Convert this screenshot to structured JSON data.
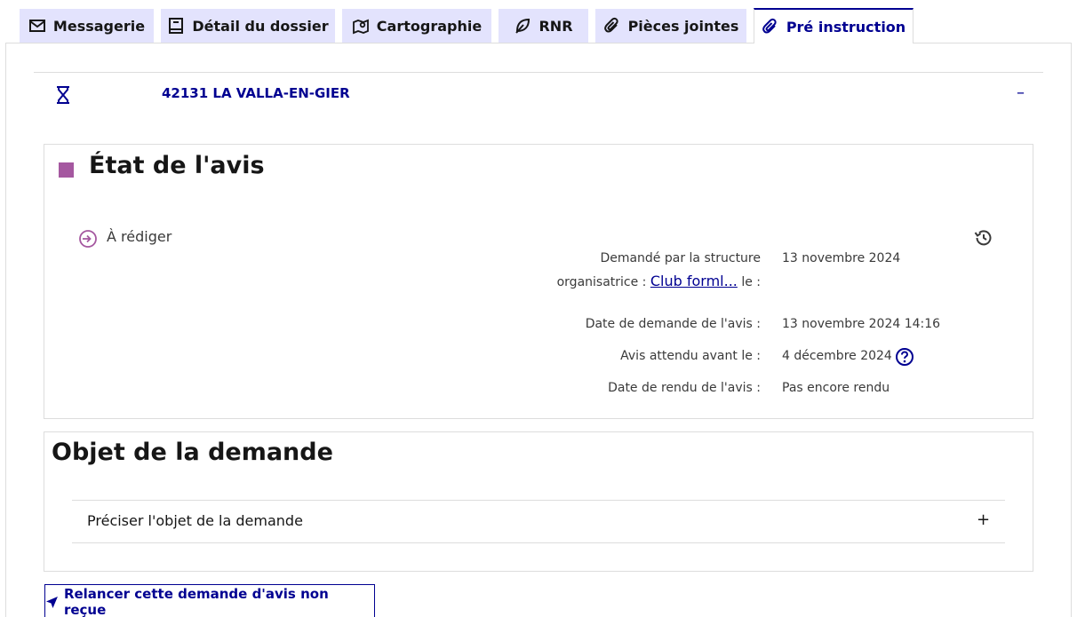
{
  "tabs": [
    {
      "label": "Messagerie",
      "icon": "mail-icon"
    },
    {
      "label": "Détail du dossier",
      "icon": "book-icon"
    },
    {
      "label": "Cartographie",
      "icon": "map-pin-icon"
    },
    {
      "label": "RNR",
      "icon": "leaf-icon"
    },
    {
      "label": "Pièces jointes",
      "icon": "paperclip-icon"
    },
    {
      "label": "Pré instruction",
      "icon": "paperclip-icon",
      "active": true
    }
  ],
  "accordion": {
    "title": "42131 LA VALLA-EN-GIER",
    "toggle": "–"
  },
  "avis": {
    "title": "État de l'avis",
    "status_color": "#a558a0",
    "status": "À rédiger",
    "requested_by_label_1": "Demandé par la structure",
    "requested_by_label_2": "organisatrice :",
    "requested_by_link": "Club forml...",
    "requested_by_label_3": "le :",
    "requested_by_value": "13 novembre 2024",
    "request_date_label": "Date de demande de l'avis :",
    "request_date_value": "13 novembre 2024 14:16",
    "expected_label": "Avis attendu avant le :",
    "expected_value": "4 décembre 2024",
    "returned_label": "Date de rendu de l'avis  :",
    "returned_value": "Pas encore rendu"
  },
  "objet": {
    "title": "Objet de la demande",
    "sub_label": "Préciser l'objet de la demande",
    "sub_toggle": "+"
  },
  "relancer_label": "Relancer cette demande d'avis non reçue",
  "colors": {
    "accent": "#000091",
    "tab_bg": "#e3e3fd",
    "status": "#a558a0"
  }
}
